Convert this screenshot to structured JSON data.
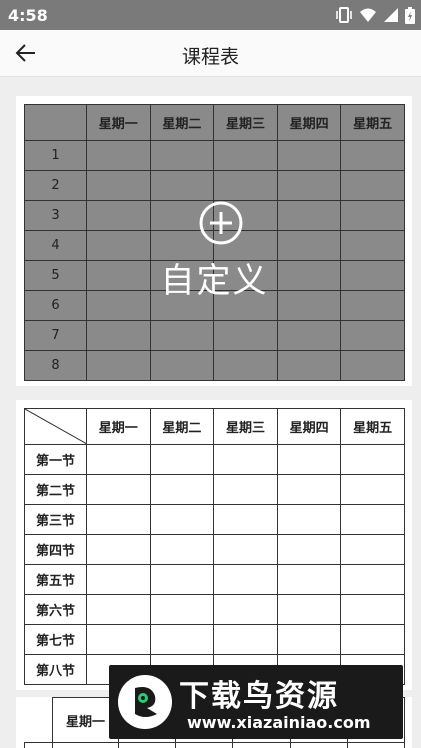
{
  "status_bar": {
    "time": "4:58"
  },
  "app_bar": {
    "title": "课程表"
  },
  "days": [
    "星期一",
    "星期二",
    "星期三",
    "星期四",
    "星期五"
  ],
  "template1": {
    "row_labels": [
      "1",
      "2",
      "3",
      "4",
      "5",
      "6",
      "7",
      "8"
    ],
    "custom_label": "自定义"
  },
  "template2": {
    "row_labels": [
      "第一节",
      "第二节",
      "第三节",
      "第四节",
      "第五节",
      "第六节",
      "第七节",
      "第八节"
    ]
  },
  "template3": {
    "first_day": "星期一"
  },
  "watermark": {
    "title": "下载鸟资源",
    "url": "www.xiazainiao.com"
  }
}
